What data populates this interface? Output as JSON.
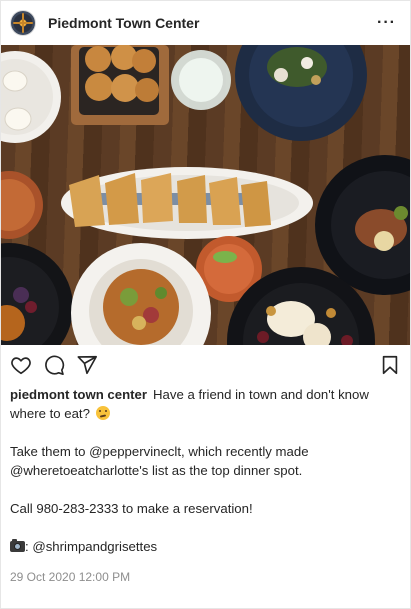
{
  "header": {
    "username": "Piedmont Town Center",
    "avatar_icon": "compass-logo",
    "more_icon": "more-horizontal-icon"
  },
  "photo": {
    "alt_icon": "food-table-photo"
  },
  "actions": {
    "like_icon": "heart-icon",
    "comment_icon": "comment-icon",
    "share_icon": "send-icon",
    "save_icon": "bookmark-icon"
  },
  "caption": {
    "user": "piedmont town center",
    "line1": "Have a friend in town and don't know where to eat?",
    "emoji": "thinking-face-emoji",
    "line2": "Take them to @peppervineclt, which recently made @wheretoeatcharlotte's list as the top dinner spot.",
    "line3": "Call 980-283-2333 to make a reservation!",
    "credit": ": @shrimpandgrisettes",
    "credit_icon": "camera-emoji"
  },
  "timestamp": "29 Oct 2020 12:00 PM",
  "colors": {
    "text": "#262626",
    "muted": "#8e8e8e",
    "border": "#e6e6e6"
  }
}
